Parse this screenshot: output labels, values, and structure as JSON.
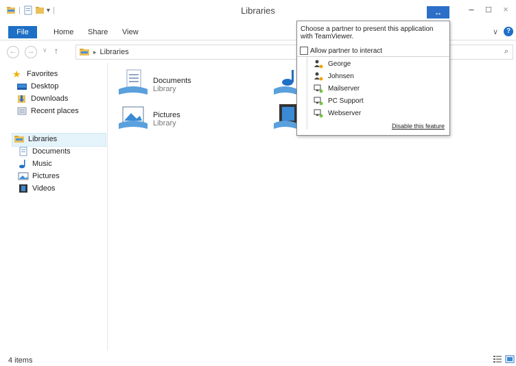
{
  "window": {
    "title": "Libraries"
  },
  "titlebar": {
    "teamviewer_button": "↔",
    "minimize": "–",
    "maximize": "□",
    "close": "×"
  },
  "ribbon": {
    "tabs": [
      {
        "label": "File"
      },
      {
        "label": "Home"
      },
      {
        "label": "Share"
      },
      {
        "label": "View"
      }
    ],
    "expand": "∨",
    "help": "?"
  },
  "address": {
    "back": "←",
    "forward": "→",
    "history": "∨",
    "up": "↑",
    "separator": "▸",
    "path": "Libraries",
    "search_icon": "⌕"
  },
  "navpane": {
    "favorites": {
      "label": "Favorites",
      "items": [
        {
          "label": "Desktop"
        },
        {
          "label": "Downloads"
        },
        {
          "label": "Recent places"
        }
      ]
    },
    "libraries": {
      "label": "Libraries",
      "items": [
        {
          "label": "Documents"
        },
        {
          "label": "Music"
        },
        {
          "label": "Pictures"
        },
        {
          "label": "Videos"
        }
      ]
    }
  },
  "content": {
    "tiles": [
      {
        "name": "Documents",
        "sub": "Library"
      },
      {
        "name": "Pictures",
        "sub": "Library"
      }
    ]
  },
  "status": {
    "items": "4 items"
  },
  "teamviewer_popup": {
    "heading": "Choose a partner to present this application with TeamViewer.",
    "allow_label": "Allow partner to interact",
    "partners": [
      {
        "name": "George",
        "type": "user"
      },
      {
        "name": "Johnsen",
        "type": "user"
      },
      {
        "name": "Mailserver",
        "type": "computer"
      },
      {
        "name": "PC Support",
        "type": "computer"
      },
      {
        "name": "Webserver",
        "type": "computer"
      }
    ],
    "disable_link": "Disable this feature"
  },
  "colors": {
    "accent": "#1e6fc6",
    "teamviewer": "#2c6ec8",
    "online": "#7ac143",
    "away": "#f0a30a"
  }
}
